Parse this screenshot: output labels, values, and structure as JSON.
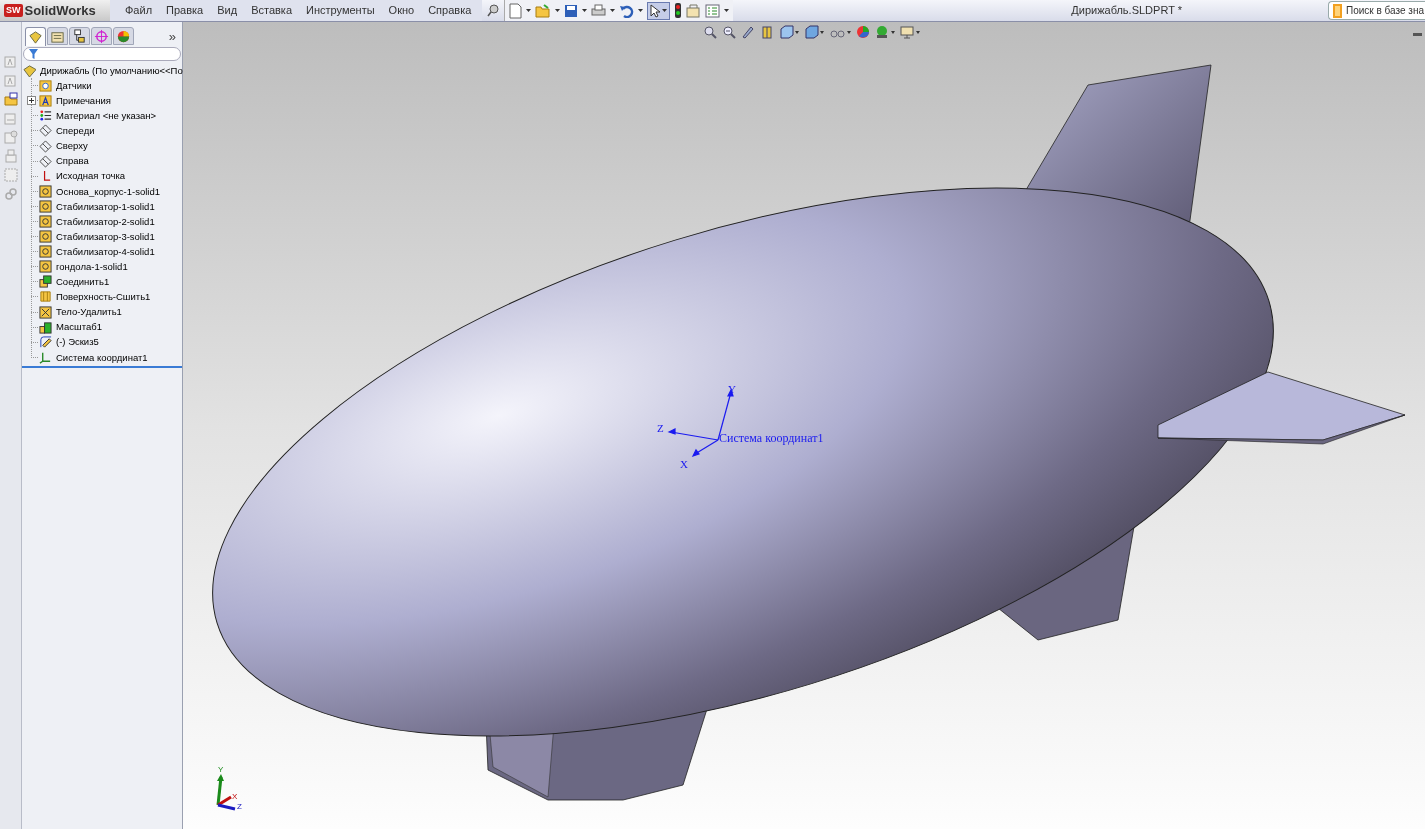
{
  "app": {
    "logo_badge": "SW",
    "logo_text": "SolidWorks"
  },
  "menu": [
    "Файл",
    "Правка",
    "Вид",
    "Вставка",
    "Инструменты",
    "Окно",
    "Справка"
  ],
  "window": {
    "title": "Дирижабль.SLDPRT *"
  },
  "search": {
    "placeholder": "Поиск в базе зна"
  },
  "panel_tabs": [
    {
      "kind": "tree",
      "selected": true
    },
    {
      "kind": "property",
      "selected": false
    },
    {
      "kind": "config",
      "selected": false
    },
    {
      "kind": "dim",
      "selected": false
    },
    {
      "kind": "display",
      "selected": false
    }
  ],
  "panel_more": "»",
  "tree": {
    "root": {
      "label": "Дирижабль  (По умолчанию<<По",
      "kind": "part"
    },
    "items": [
      {
        "label": "Датчики",
        "kind": "sensors"
      },
      {
        "label": "Примечания",
        "kind": "annotations",
        "expanded": false
      },
      {
        "label": "Материал <не указан>",
        "kind": "material"
      },
      {
        "label": "Спереди",
        "kind": "plane"
      },
      {
        "label": "Сверху",
        "kind": "plane"
      },
      {
        "label": "Справа",
        "kind": "plane"
      },
      {
        "label": "Исходная точка",
        "kind": "origin"
      },
      {
        "label": "Основа_корпус-1-solid1",
        "kind": "body"
      },
      {
        "label": "Стабилизатор-1-solid1",
        "kind": "body"
      },
      {
        "label": "Стабилизатор-2-solid1",
        "kind": "body"
      },
      {
        "label": "Стабилизатор-3-solid1",
        "kind": "body"
      },
      {
        "label": "Стабилизатор-4-solid1",
        "kind": "body"
      },
      {
        "label": "гондола-1-solid1",
        "kind": "body"
      },
      {
        "label": "Соединить1",
        "kind": "combine"
      },
      {
        "label": "Поверхность-Сшить1",
        "kind": "surface"
      },
      {
        "label": "Тело-Удалить1",
        "kind": "delete"
      },
      {
        "label": "Масштаб1",
        "kind": "scale"
      },
      {
        "label": "(-) Эскиз5",
        "kind": "sketch"
      },
      {
        "label": "Система координат1",
        "kind": "coordsys"
      }
    ]
  },
  "model": {
    "triad_label": "Система координат1",
    "axis_x": "X",
    "axis_y": "Y",
    "axis_z": "Z"
  },
  "view_triad": {
    "axis_x": "X",
    "axis_y": "Y",
    "axis_z": "Z"
  }
}
